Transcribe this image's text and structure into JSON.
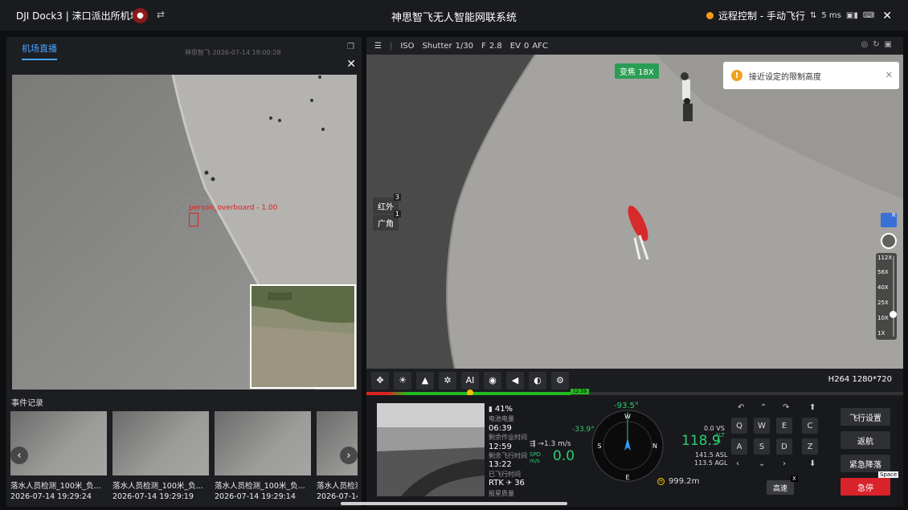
{
  "topbar": {
    "title": "DJI Dock3 | 涞口派出所机场",
    "swap_icon": "swap-icon",
    "system_title": "神思智飞无人智能网联系统",
    "mode": "远程控制 - 手动飞行",
    "latency": "5 ms",
    "status_color": "#f39c12"
  },
  "left": {
    "tab": "机场直播",
    "detection_label": "person_overboard - 1.00",
    "events_title": "事件记录",
    "events": [
      {
        "caption": "落水人员检测_100米_负...",
        "time": "2026-07-14 19:29:24"
      },
      {
        "caption": "落水人员检测_100米_负...",
        "time": "2026-07-14 19:29:19"
      },
      {
        "caption": "落水人员检测_100米_负...",
        "time": "2026-07-14 19:29:14"
      },
      {
        "caption": "落水人员检测",
        "time": "2026-07-14"
      }
    ],
    "watermark": "神思智飞 2026-07-14 19:00:28"
  },
  "camera": {
    "iso_label": "ISO",
    "shutter_label": "Shutter",
    "shutter_value": "1/30",
    "f_label": "F",
    "f_value": "2.8",
    "ev_label": "EV",
    "ev_value": "0",
    "focus_mode": "AFC",
    "zoom_badge": "变焦 18X",
    "toast": "接近设定的限制高度",
    "lens_ir": "红外",
    "lens_ir_key": "3",
    "lens_wide": "广角",
    "lens_wide_key": "1",
    "side_key": "R",
    "zoom_ticks": [
      "112X",
      "56X",
      "40X",
      "25X",
      "10X",
      "1X"
    ],
    "zoom_level_fraction": 0.72,
    "codec": "H264 1280*720",
    "timeline_time": "12:59",
    "timeline_progress": 0.39
  },
  "tools": [
    "move-icon",
    "light-icon",
    "navigate-icon",
    "laser-icon",
    "AI",
    "target-icon",
    "speaker-icon",
    "spotlight-icon",
    "settings-icon"
  ],
  "tools_ai_label": "AI",
  "telemetry": {
    "battery": "41%",
    "battery_label": "电池电量",
    "work_time": "06:39",
    "work_time_label": "剩余作业时间",
    "remaining_flight": "12:59",
    "remaining_flight_label": "剩余飞行时间",
    "flown": "13:22",
    "flown_label": "已飞行时间",
    "rtk_label": "RTK",
    "rtk_value": "36",
    "signal_label": "报星质量",
    "wind_speed": "1.3 m/s",
    "spd_label": "SPD\nm/s",
    "speed": "0.0",
    "heading": "-93.5°",
    "pitch": "-33.9°",
    "vs": "0.0 VS",
    "alt": "118.9",
    "alt_label": "ALT\nm",
    "asl": "141.5 ASL",
    "agl": "113.5 AGL",
    "distance": "999.2m",
    "home_label": "H",
    "compass": [
      "N",
      "E",
      "S",
      "W"
    ]
  },
  "keys": {
    "row1": [
      "Q",
      "W",
      "E",
      "C"
    ],
    "row2": [
      "A",
      "S",
      "D",
      "Z"
    ],
    "fast": "高速",
    "fast_key": "X"
  },
  "actions": {
    "settings": "飞行设置",
    "return": "返航",
    "land": "紧急降落",
    "stop": "急停",
    "stop_key": "Space"
  }
}
